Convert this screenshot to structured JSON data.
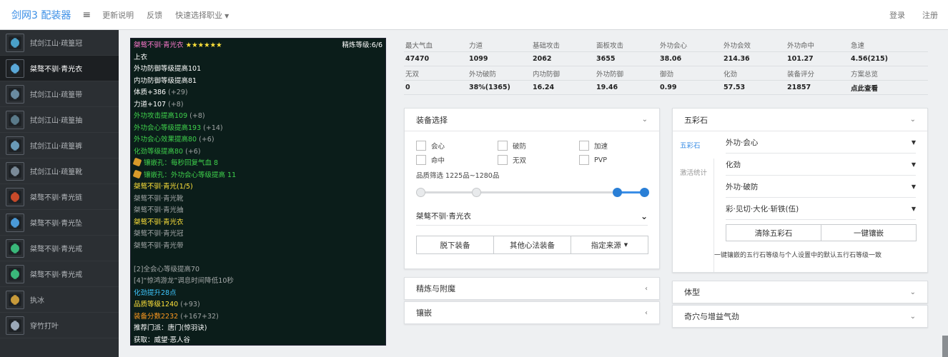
{
  "nav": {
    "brand": "剑网3 配装器",
    "links": [
      "更新说明",
      "反馈"
    ],
    "quick_select": "快速选择职业",
    "login": "登录",
    "register": "注册"
  },
  "sidebar": {
    "items": [
      {
        "label": "拭剑江山·疏篁冠",
        "icon": "helmet-icon",
        "color": "#4aa0c8"
      },
      {
        "label": "桀骜不驯·青光衣",
        "icon": "chest-armor-icon",
        "color": "#5aa8d8"
      },
      {
        "label": "拭剑江山·疏篁带",
        "icon": "belt-icon",
        "color": "#6a8aa0"
      },
      {
        "label": "拭剑江山·疏篁抽",
        "icon": "bracer-icon",
        "color": "#5a7a8a"
      },
      {
        "label": "拭剑江山·疏篁裤",
        "icon": "pants-icon",
        "color": "#6a9ab8"
      },
      {
        "label": "拭剑江山·疏篁靴",
        "icon": "boots-icon",
        "color": "#7a8a98"
      },
      {
        "label": "桀骜不驯·青光链",
        "icon": "necklace-icon",
        "color": "#c84a2a"
      },
      {
        "label": "桀骜不驯·青光坠",
        "icon": "pendant-icon",
        "color": "#4a9ad8"
      },
      {
        "label": "桀骜不驯·青光戒",
        "icon": "ring-icon",
        "color": "#3ab87a"
      },
      {
        "label": "桀骜不驯·青光戒",
        "icon": "ring-icon",
        "color": "#3ab87a"
      },
      {
        "label": "执冰",
        "icon": "weapon-icon",
        "color": "#c89a3a"
      },
      {
        "label": "穿竹打叶",
        "icon": "dart-icon",
        "color": "#9aa8b8"
      }
    ]
  },
  "tooltip": {
    "name": "桀骜不驯·青光衣",
    "stars": "★★★★★★",
    "refine": "精炼等级:6/6",
    "slot": "上衣",
    "base_lines": [
      "外功防御等级提高101",
      "内功防御等级提高81"
    ],
    "attr_lines": [
      {
        "text": "体质+386",
        "bonus": "(+29)"
      },
      {
        "text": "力道+107",
        "bonus": "(+8)"
      }
    ],
    "green_lines": [
      {
        "text": "外功攻击提高109",
        "bonus": "(+8)"
      },
      {
        "text": "外功会心等级提高193",
        "bonus": "(+14)"
      },
      {
        "text": "外功会心效果提高80",
        "bonus": "(+6)"
      },
      {
        "text": "化劲等级提高80",
        "bonus": "(+6)"
      }
    ],
    "slots": [
      "镶嵌孔：每秒回复气血 8",
      "镶嵌孔：外功会心等级提高 11"
    ],
    "set_name": "桀骜不驯·青光(1/5)",
    "set_items": [
      {
        "text": "桀骜不驯·青光靴",
        "active": false
      },
      {
        "text": "桀骜不驯·青光抽",
        "active": false
      },
      {
        "text": "桀骜不驯·青光衣",
        "active": true
      },
      {
        "text": "桀骜不驯·青光冠",
        "active": false
      },
      {
        "text": "桀骜不驯·青光带",
        "active": false
      }
    ],
    "set_bonus": [
      "[2]全会心等级提高70",
      "[4]“惊鸿游龙”调息时间降低10秒"
    ],
    "huajin": "化劲提升28点",
    "quality": {
      "text": "品质等级1240",
      "bonus": "(+93)"
    },
    "score": {
      "text": "装备分数2232",
      "bonus": "(+167+32)"
    },
    "recommend": "推荐门派：唐门(惊羽诀)",
    "source": "获取：威望·恶人谷"
  },
  "stats": {
    "row1_labels": [
      "最大气血",
      "力道",
      "基础攻击",
      "面板攻击",
      "外功会心",
      "外功会效",
      "外功命中",
      "急速"
    ],
    "row1_values": [
      "47470",
      "1099",
      "2062",
      "3655",
      "38.06",
      "214.36",
      "101.27",
      "4.56(215)"
    ],
    "row2_labels": [
      "无双",
      "外功破防",
      "内功防御",
      "外功防御",
      "御劲",
      "化劲",
      "装备评分",
      "方案总览"
    ],
    "row2_values": [
      "0",
      "38%(1365)",
      "16.24",
      "19.46",
      "0.99",
      "57.53",
      "21857",
      "点此查看"
    ]
  },
  "equip": {
    "title": "装备选择",
    "filters": [
      "会心",
      "破防",
      "加速",
      "命中",
      "无双",
      "PVP"
    ],
    "quality_label": "品质筛选 1225品~1280品",
    "slider": {
      "min_fraction": 0.0,
      "mid_fraction": 0.25,
      "low": 0.88,
      "high": 1.0
    },
    "selected": "桀骜不驯·青光衣",
    "buttons": {
      "unequip": "脱下装备",
      "other": "其他心法装备",
      "source": "指定来源"
    }
  },
  "refine_panel": {
    "title": "精炼与附魔"
  },
  "inlay_panel": {
    "title": "镶嵌"
  },
  "gems": {
    "title": "五彩石",
    "tabs": [
      "五彩石",
      "激活统计"
    ],
    "selects": [
      "外功·会心",
      "化劲",
      "外功·破防",
      "彩·见切·大化·斩铁(伍)"
    ],
    "clear": "清除五彩石",
    "inlay_all": "一键镶嵌",
    "note": "一键镶嵌的五行石等级与个人设置中的默认五行石等级一致"
  },
  "body_type": {
    "title": "体型"
  },
  "qixue": {
    "title": "奇穴与增益气劲"
  }
}
